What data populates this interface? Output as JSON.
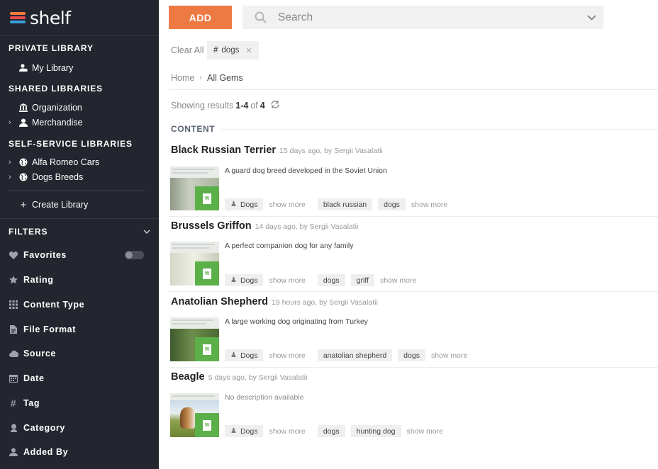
{
  "app": {
    "name": "shelf",
    "accent": "#ee7a43",
    "sidebar_bg": "#23262e"
  },
  "sidebar": {
    "private_heading": "PRIVATE LIBRARY",
    "my_library": "My Library",
    "shared_heading": "SHARED LIBRARIES",
    "organization": "Organization",
    "merchandise": "Merchandise",
    "self_service_heading": "SELF-SERVICE LIBRARIES",
    "alfa_romeo": "Alfa Romeo Cars",
    "dogs_breeds": "Dogs Breeds",
    "create_library": "Create Library",
    "filters_heading": "FILTERS",
    "filters": [
      {
        "label": "Favorites",
        "icon": "heart-icon"
      },
      {
        "label": "Rating",
        "icon": "star-icon"
      },
      {
        "label": "Content Type",
        "icon": "grid-icon"
      },
      {
        "label": "File Format",
        "icon": "file-icon"
      },
      {
        "label": "Source",
        "icon": "cloud-icon"
      },
      {
        "label": "Date",
        "icon": "calendar-icon"
      },
      {
        "label": "Tag",
        "icon": "hash-icon"
      },
      {
        "label": "Category",
        "icon": "category-icon"
      },
      {
        "label": "Added By",
        "icon": "user-icon"
      }
    ],
    "favorites_toggle": false
  },
  "toolbar": {
    "add_label": "ADD",
    "search_placeholder": "Search"
  },
  "filter_bar": {
    "clear_all": "Clear All",
    "active_tag": "dogs"
  },
  "breadcrumb": {
    "home": "Home",
    "current": "All Gems"
  },
  "results": {
    "prefix": "Showing results",
    "range": "1-4",
    "of": "of",
    "total": "4"
  },
  "content_heading": "CONTENT",
  "gems": [
    {
      "title": "Black Russian Terrier",
      "meta": "15 days ago, by  Sergii Vasalatii",
      "description": "A guard dog breed developed in the Soviet Union",
      "category": "Dogs",
      "show_more_1": "show more",
      "tags": [
        "black russian",
        "dogs"
      ],
      "show_more_2": "show more"
    },
    {
      "title": "Brussels Griffon",
      "meta": "14 days ago, by  Sergii Vasalatii",
      "description": "A perfect companion dog for any family",
      "category": "Dogs",
      "show_more_1": "show more",
      "tags": [
        "dogs",
        "griff"
      ],
      "show_more_2": "show more"
    },
    {
      "title": "Anatolian Shepherd",
      "meta": "19 hours ago, by  Sergii Vasalatii",
      "description": "A large working dog originating from Turkey",
      "category": "Dogs",
      "show_more_1": "show more",
      "tags": [
        "anatolian shepherd",
        "dogs"
      ],
      "show_more_2": "show more"
    },
    {
      "title": "Beagle",
      "meta": "5 days ago, by  Sergii Vasalatii",
      "description": "No description available",
      "category": "Dogs",
      "show_more_1": "show more",
      "tags": [
        "dogs",
        "hunting dog"
      ],
      "show_more_2": "show more"
    }
  ]
}
